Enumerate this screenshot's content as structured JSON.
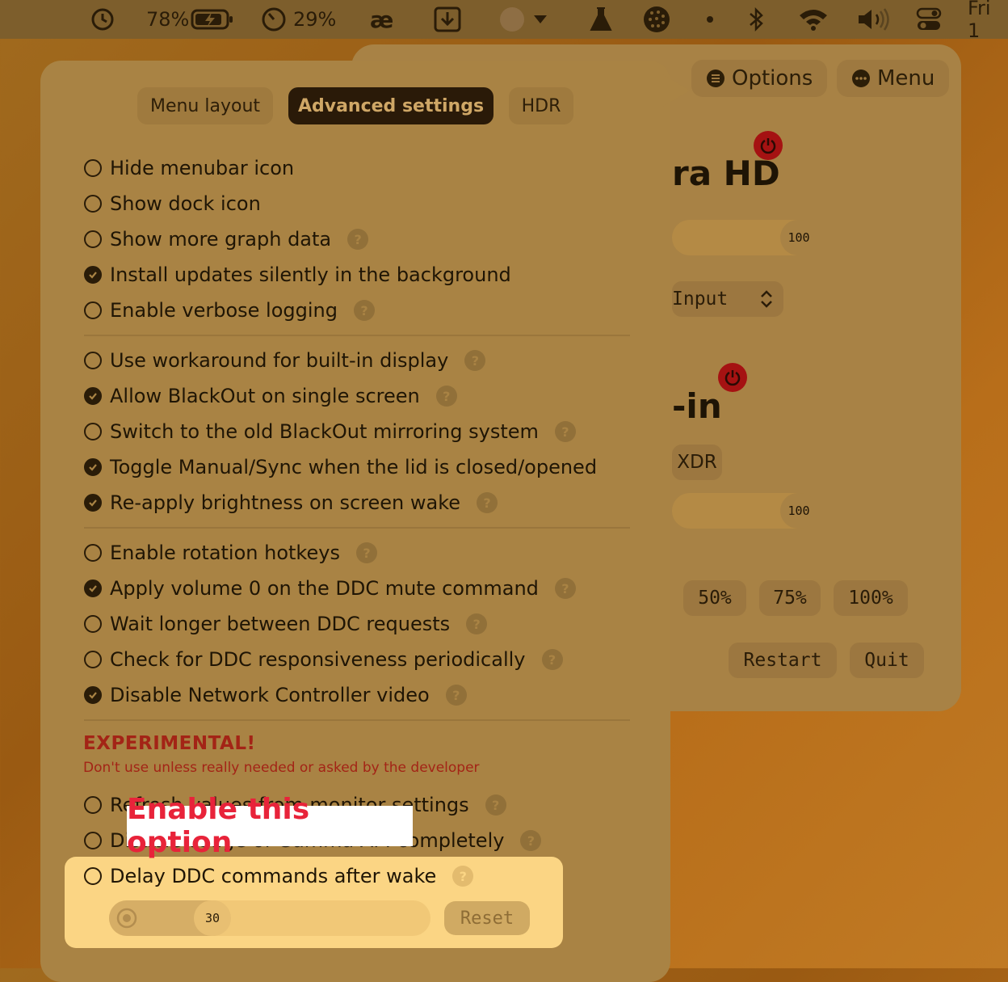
{
  "menubar": {
    "battery_percent": "78%",
    "cpu_percent": "29%",
    "ae_glyph": "æ",
    "clock": "Fri 1",
    "icons": [
      "time-machine-icon",
      "battery-charging-icon",
      "gauge-icon",
      "ae-icon",
      "download-icon",
      "avatar",
      "chevron-down-icon",
      "flask-icon",
      "pattern-icon",
      "dot-icon",
      "bluetooth-icon",
      "wifi-icon",
      "volume-icon",
      "control-center-icon"
    ]
  },
  "background_window": {
    "options_label": "Options",
    "menu_label": "Menu",
    "display1_title": "ra HD",
    "display1_brightness": "100",
    "input_label": "Input",
    "display2_title": "-in",
    "xdr_label": "XDR",
    "display2_brightness": "100",
    "presets": [
      "50%",
      "75%",
      "100%"
    ],
    "restart_label": "Restart",
    "quit_label": "Quit"
  },
  "tabs": [
    {
      "label": "Menu layout",
      "active": false
    },
    {
      "label": "Advanced settings",
      "active": true
    },
    {
      "label": "HDR",
      "active": false
    }
  ],
  "options_group1": [
    {
      "label": "Hide menubar icon",
      "checked": false,
      "help": false
    },
    {
      "label": "Show dock icon",
      "checked": false,
      "help": false
    },
    {
      "label": "Show more graph data",
      "checked": false,
      "help": true
    },
    {
      "label": "Install updates silently in the background",
      "checked": true,
      "help": false
    },
    {
      "label": "Enable verbose logging",
      "checked": false,
      "help": true
    }
  ],
  "options_group2": [
    {
      "label": "Use workaround for built-in display",
      "checked": false,
      "help": true
    },
    {
      "label": "Allow BlackOut on single screen",
      "checked": true,
      "help": true
    },
    {
      "label": "Switch to the old BlackOut mirroring system",
      "checked": false,
      "help": true
    },
    {
      "label": "Toggle Manual/Sync when the lid is closed/opened",
      "checked": true,
      "help": false
    },
    {
      "label": "Re-apply brightness on screen wake",
      "checked": true,
      "help": true
    }
  ],
  "options_group3": [
    {
      "label": "Enable rotation hotkeys",
      "checked": false,
      "help": true
    },
    {
      "label": "Apply volume 0 on the DDC mute command",
      "checked": true,
      "help": true
    },
    {
      "label": "Wait longer between DDC requests",
      "checked": false,
      "help": true
    },
    {
      "label": "Check for DDC responsiveness periodically",
      "checked": false,
      "help": true
    },
    {
      "label": "Disable Network Controller video",
      "checked": true,
      "help": true
    }
  ],
  "experimental": {
    "title": "EXPERIMENTAL!",
    "subtitle": "Don't use unless really needed or asked by the developer",
    "options": [
      {
        "label": "Refresh values from monitor settings",
        "checked": false,
        "help": true
      },
      {
        "label": "Disable usage of Gamma API completely",
        "checked": false,
        "help": true
      }
    ]
  },
  "delay_option": {
    "label": "Delay DDC commands after wake",
    "checked": false,
    "value": "30",
    "value_fraction": 0.3,
    "reset_label": "Reset"
  },
  "callout": {
    "text": "Enable this option"
  },
  "help_glyph": "?"
}
